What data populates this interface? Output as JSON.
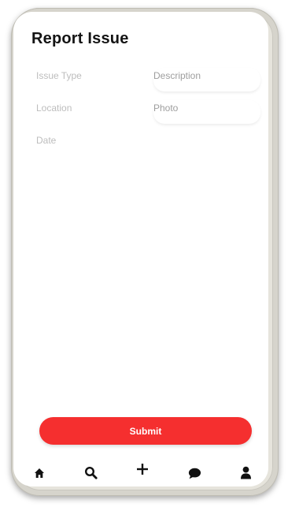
{
  "header": {
    "title": "Report Issue"
  },
  "form": {
    "issue_type_placeholder": "Issue Type",
    "description_placeholder": "Description",
    "location_placeholder": "Location",
    "photo_placeholder": "Photo",
    "date_placeholder": "Date",
    "submit_label": "Submit"
  },
  "bottom_nav": {
    "items": [
      {
        "icon": "home-icon"
      },
      {
        "icon": "search-icon"
      },
      {
        "icon": "plus-icon"
      },
      {
        "icon": "chat-bubble-icon"
      },
      {
        "icon": "user-icon"
      }
    ]
  },
  "colors": {
    "accent": "#f52f2f",
    "title_text": "#141414",
    "placeholder_text": "#bdbdbd",
    "frame": "#d6d4cc",
    "icon": "#111111"
  }
}
